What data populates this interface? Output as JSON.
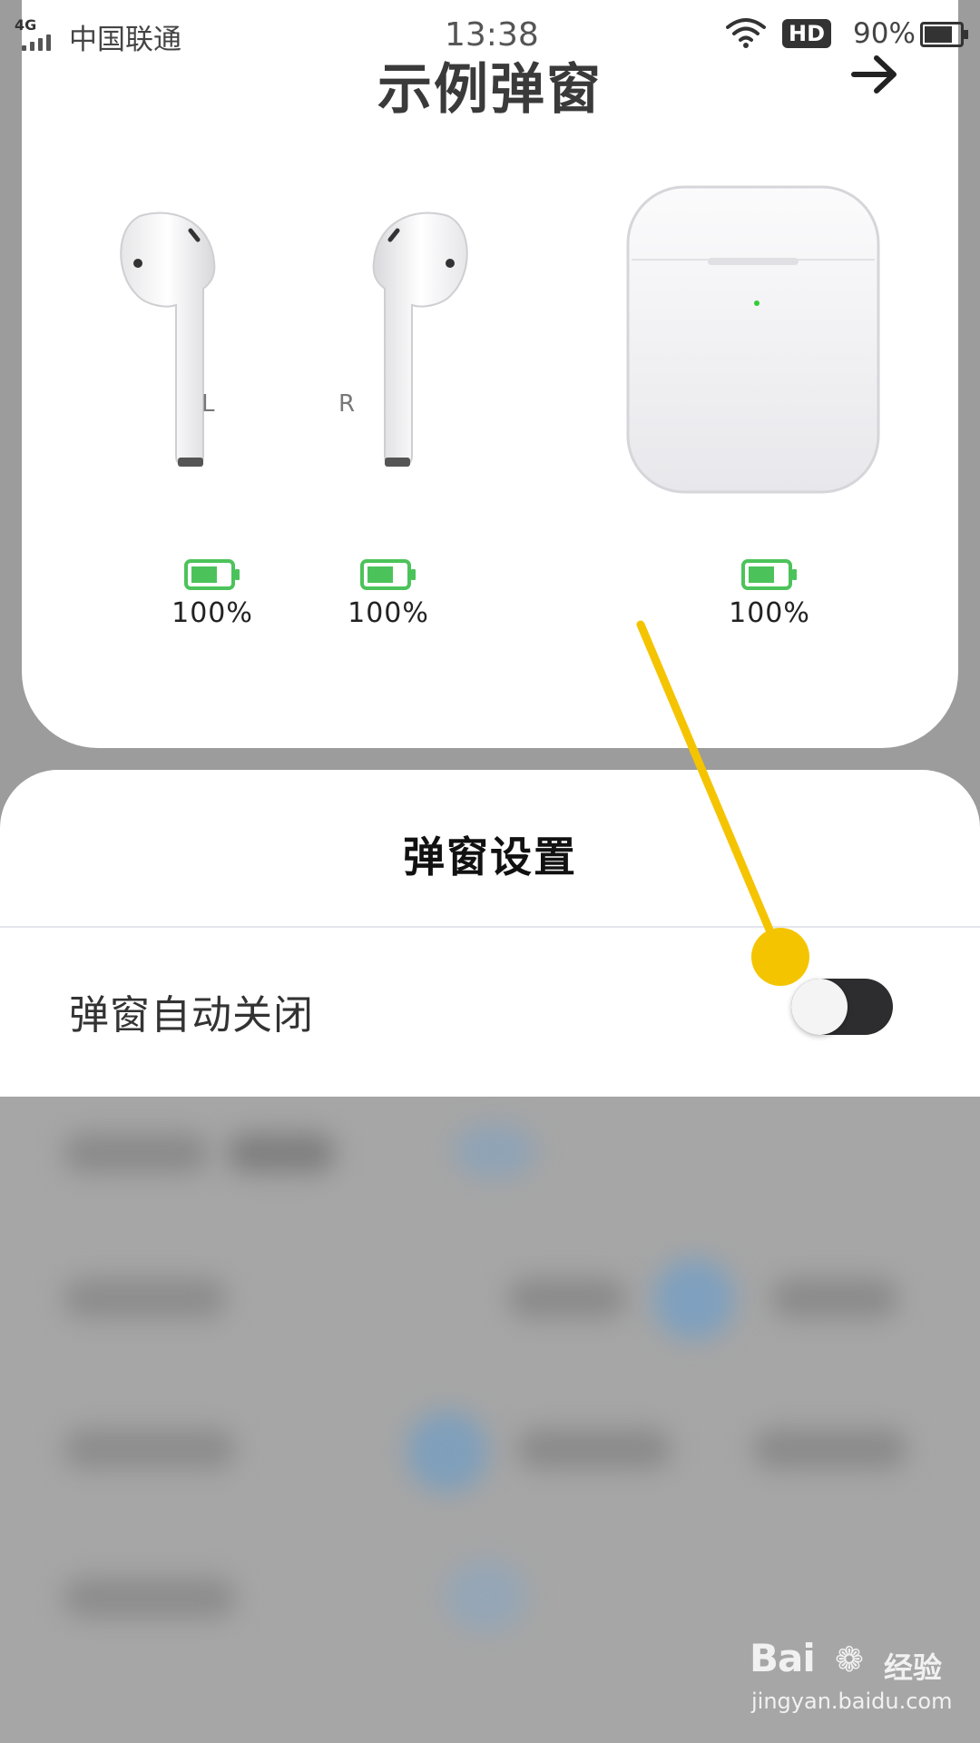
{
  "status_bar": {
    "network": "4G",
    "carrier": "中国联通",
    "time": "13:38",
    "hd_badge": "HD",
    "battery_percent": "90%"
  },
  "popup": {
    "title": "示例弹窗",
    "earbuds": [
      {
        "side": "L",
        "battery": "100%"
      },
      {
        "side": "R",
        "battery": "100%"
      }
    ],
    "case": {
      "battery": "100%"
    },
    "colors": {
      "battery_green": "#4cc35a",
      "case_led": "#33cc33"
    }
  },
  "settings_sheet": {
    "title": "弹窗设置",
    "auto_close": {
      "label": "弹窗自动关闭",
      "enabled": false
    }
  },
  "annotation_color": "#f5c400",
  "watermark": {
    "brand": "Bai",
    "brand_suffix": "经验",
    "url": "jingyan.baidu.com"
  }
}
